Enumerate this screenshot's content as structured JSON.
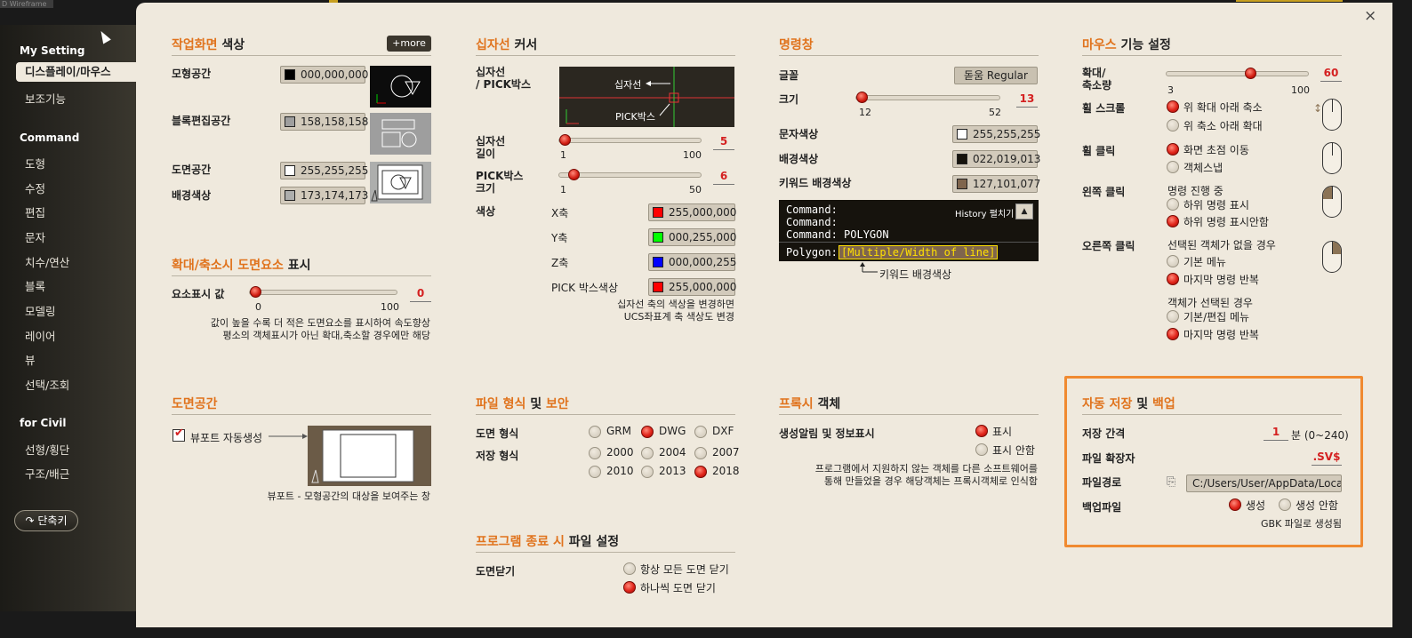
{
  "window_fragment": "D Wireframe",
  "sidebar": {
    "section1": "My Setting",
    "items1": [
      "디스플레이/마우스",
      "보조기능"
    ],
    "section2": "Command",
    "items2": [
      "도형",
      "수정",
      "편집",
      "문자",
      "치수/연산",
      "블록",
      "모델링",
      "레이어",
      "뷰",
      "선택/조회"
    ],
    "section3": "for Civil",
    "items3": [
      "선형/횡단",
      "구조/배근"
    ],
    "shortcut": "단축키"
  },
  "close": "×",
  "workspace": {
    "title_accent": "작업화면",
    "title_rest": " 색상",
    "more": "+more",
    "rows": [
      {
        "label": "모형공간",
        "value": "000,000,000",
        "color": "#000000"
      },
      {
        "label": "블록편집공간",
        "value": "158,158,158",
        "color": "#9e9e9e"
      },
      {
        "label": "도면공간",
        "value": "255,255,255",
        "color": "#ffffff"
      },
      {
        "label": "배경색상",
        "value": "173,174,173",
        "color": "#adaead"
      }
    ]
  },
  "zoom_elements": {
    "title_accent": "확대/축소시 도면요소",
    "title_rest": " 표시",
    "label": "요소표시 값",
    "min": "0",
    "max": "100",
    "value": "0",
    "note1": "값이 높을 수록 더 적은 도면요소를 표시하여 속도향상",
    "note2": "평소의 객체표시가 아닌 확대,축소할 경우에만 해당"
  },
  "crosshair": {
    "title_accent": "십자선",
    "title_rest": " 커서",
    "label": "십자선\n/ PICK박스",
    "preview_cross": "십자선",
    "preview_pick": "PICK박스",
    "len_label": "십자선\n길이",
    "len_min": "1",
    "len_max": "100",
    "len_value": "5",
    "pick_label": "PICK박스\n크기",
    "pick_min": "1",
    "pick_max": "50",
    "pick_value": "6",
    "color_label": "색상",
    "axes": [
      {
        "label": "X축",
        "value": "255,000,000",
        "color": "#ff0000"
      },
      {
        "label": "Y축",
        "value": "000,255,000",
        "color": "#00ff00"
      },
      {
        "label": "Z축",
        "value": "000,000,255",
        "color": "#0000ff"
      },
      {
        "label": "PICK 박스색상",
        "value": "255,000,000",
        "color": "#ff0000"
      }
    ],
    "note1": "십자선 축의 색상을 변경하면",
    "note2": "UCS좌표계 축 색상도 변경"
  },
  "command": {
    "title": "명령창",
    "font_label": "글꼴",
    "font_value": "돋움 Regular",
    "size_label": "크기",
    "size_min": "12",
    "size_max": "52",
    "size_value": "13",
    "text_color_label": "문자색상",
    "text_color_value": "255,255,255",
    "text_color": "#ffffff",
    "bg_color_label": "배경색상",
    "bg_color_value": "022,019,013",
    "bg_color": "#16130d",
    "kw_color_label": "키워드 배경색상",
    "kw_color_value": "127,101,077",
    "kw_color": "#7f654d",
    "console_lines": [
      "Command:",
      "Command:",
      "Command: POLYGON"
    ],
    "history": "History 펼치기",
    "prompt": "Polygon: ",
    "keyword": "[Multiple/Width of line]",
    "kw_caption": "키워드 배경색상"
  },
  "mouse": {
    "title_accent": "마우스",
    "title_rest": " 기능 설정",
    "zoom_label": "확대/\n축소량",
    "zoom_min": "3",
    "zoom_max": "100",
    "zoom_value": "60",
    "scroll_label": "휠 스크롤",
    "scroll_opts": [
      "위 확대 아래 축소",
      "위 축소 아래 확대"
    ],
    "wheel_label": "휠 클릭",
    "wheel_opts": [
      "화면 초점 이동",
      "객체스냅"
    ],
    "left_label": "왼쪽 클릭",
    "left_head": "명령 진행 중",
    "left_opts": [
      "하위 명령 표시",
      "하위 명령 표시안함"
    ],
    "right_label": "오른쪽 클릭",
    "right_head1": "선택된 객체가 없을 경우",
    "right_opts1": [
      "기본 메뉴",
      "마지막 명령 반복"
    ],
    "right_head2": "객체가 선택된 경우",
    "right_opts2": [
      "기본/편집 메뉴",
      "마지막 명령 반복"
    ]
  },
  "paperspace": {
    "title": "도면공간",
    "checkbox": "뷰포트 자동생성",
    "note": "뷰포트 - 모형공간의 대상을 보여주는 창"
  },
  "fileformat": {
    "title_accent1": "파일 형식",
    "mid": " 및 ",
    "title_accent2": "보안",
    "drawing_label": "도면 형식",
    "drawing_opts": [
      "GRM",
      "DWG",
      "DXF"
    ],
    "save_label": "저장 형식",
    "save_opts": [
      "2000",
      "2004",
      "2007",
      "2010",
      "2013",
      "2018"
    ]
  },
  "exit": {
    "title_accent": "프로그램 종료 시",
    "title_rest": " 파일 설정",
    "label": "도면닫기",
    "opts": [
      "항상 모든 도면 닫기",
      "하나씩 도면 닫기"
    ]
  },
  "proxy": {
    "title_accent": "프록시",
    "title_rest": " 객체",
    "label": "생성알림 및 정보표시",
    "opts": [
      "표시",
      "표시 안함"
    ],
    "note1": "프로그램에서 지원하지 않는 객체를 다른 소프트웨어를",
    "note2": "통해 만들었을 경우 해당객체는 프록시객체로 인식함"
  },
  "autosave": {
    "title_accent1": "자동 저장",
    "mid": " 및 ",
    "title_accent2": "백업",
    "interval_label": "저장 간격",
    "interval_value": "1",
    "interval_unit": "분 (0~240)",
    "ext_label": "파일 확장자",
    "ext_value": ".SV$",
    "path_label": "파일경로",
    "path_value": "C:/Users/User/AppData/Local/T...",
    "backup_label": "백업파일",
    "backup_opts": [
      "생성",
      "생성 안함"
    ],
    "backup_note": "GBK 파일로 생성됨"
  },
  "colors": {
    "accent": "#e0731d",
    "highlight": "#f08a30",
    "panel": "#efe9dd"
  }
}
